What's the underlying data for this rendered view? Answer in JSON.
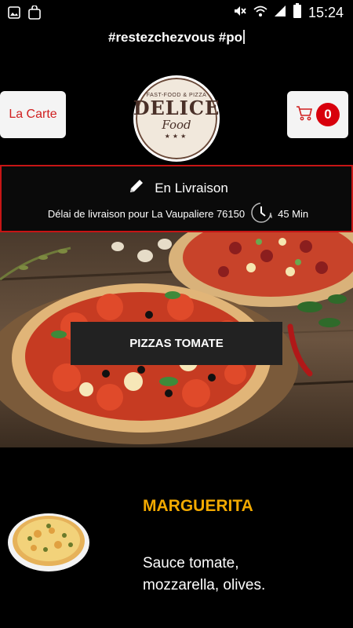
{
  "status_bar": {
    "time": "15:24",
    "left_icons": [
      "image-icon",
      "bag-icon"
    ],
    "right_icons": [
      "mute-icon",
      "wifi-icon",
      "signal-icon",
      "battery-icon"
    ]
  },
  "marquee": {
    "text": "#restezchezvous #po"
  },
  "header": {
    "menu_button_label": "La Carte",
    "cart_count": "0",
    "logo": {
      "top_text": "FAST-FOOD & PIZZA",
      "main_text": "DELICE",
      "sub_text": "Food",
      "stars": "★★★"
    }
  },
  "delivery": {
    "mode": "En Livraison",
    "info_text": "Délai de livraison pour La Vaupaliere 76150",
    "time": "45 Min"
  },
  "hero": {
    "category_button": "PIZZAS TOMATE"
  },
  "product": {
    "name": "MARGUERITA",
    "description": "Sauce tomate, mozzarella, olives."
  },
  "colors": {
    "accent_red": "#d8000c",
    "title_orange": "#f2a900",
    "border_red": "#c61515"
  }
}
